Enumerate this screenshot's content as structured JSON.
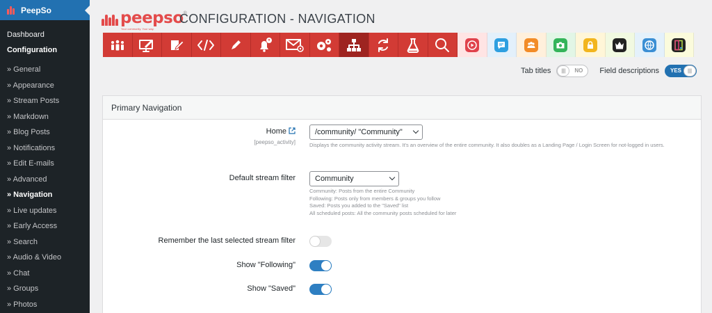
{
  "sidebar": {
    "title": "PeepSo",
    "top_items": [
      {
        "label": "Dashboard",
        "current": false
      },
      {
        "label": "Configuration",
        "current": true
      }
    ],
    "sub_items": [
      {
        "label": "» General",
        "active": false
      },
      {
        "label": "» Appearance",
        "active": false
      },
      {
        "label": "» Stream Posts",
        "active": false
      },
      {
        "label": "» Markdown",
        "active": false
      },
      {
        "label": "» Blog Posts",
        "active": false
      },
      {
        "label": "» Notifications",
        "active": false
      },
      {
        "label": "» Edit E-mails",
        "active": false
      },
      {
        "label": "» Advanced",
        "active": false
      },
      {
        "label": "» Navigation",
        "active": true
      },
      {
        "label": "» Live updates",
        "active": false
      },
      {
        "label": "» Early Access",
        "active": false
      },
      {
        "label": "» Search",
        "active": false
      },
      {
        "label": "» Audio & Video",
        "active": false
      },
      {
        "label": "» Chat",
        "active": false
      },
      {
        "label": "» Groups",
        "active": false
      },
      {
        "label": "» Photos",
        "active": false
      }
    ]
  },
  "brand": {
    "word": "peepso",
    "tagline": "Your community. Your way.",
    "reg": "®"
  },
  "page_title": "CONFIGURATION - NAVIGATION",
  "tabs": [
    {
      "icon": "people-icon",
      "type": "red",
      "selected": false
    },
    {
      "icon": "monitor-pen-icon",
      "type": "red",
      "selected": false
    },
    {
      "icon": "edit-note-icon",
      "type": "red",
      "selected": false
    },
    {
      "icon": "code-icon",
      "type": "red",
      "selected": false
    },
    {
      "icon": "pencil-icon",
      "type": "red",
      "selected": false
    },
    {
      "icon": "bell-alert-icon",
      "type": "red",
      "selected": false
    },
    {
      "icon": "mail-gear-icon",
      "type": "red",
      "selected": false
    },
    {
      "icon": "gears-icon",
      "type": "red",
      "selected": false
    },
    {
      "icon": "sitemap-icon",
      "type": "red",
      "selected": true
    },
    {
      "icon": "refresh-icon",
      "type": "red",
      "selected": false
    },
    {
      "icon": "flask-icon",
      "type": "red",
      "selected": false
    },
    {
      "icon": "search-icon",
      "type": "red",
      "selected": false
    },
    {
      "icon": "play-icon",
      "type": "addon",
      "bg": "#ffe4e4",
      "badge": "#e0424c"
    },
    {
      "icon": "chat-icon",
      "type": "addon",
      "bg": "#e3f0fb",
      "badge": "#2e9fe0"
    },
    {
      "icon": "group-icon",
      "type": "addon",
      "bg": "#fff0dc",
      "badge": "#f28c28"
    },
    {
      "icon": "camera-icon",
      "type": "addon",
      "bg": "#e2f6e6",
      "badge": "#34b45a"
    },
    {
      "icon": "lock-icon",
      "type": "addon",
      "bg": "#fff6d8",
      "badge": "#f2b51e"
    },
    {
      "icon": "crown-icon",
      "type": "addon",
      "bg": "#f1f9e1",
      "badge": "#222222"
    },
    {
      "icon": "globe-badge-icon",
      "type": "addon",
      "bg": "#e4f1fb",
      "badge": "#3b8fd4"
    },
    {
      "icon": "frame-icon",
      "type": "addon",
      "bg": "#fbfbdc",
      "badge": "#222222"
    }
  ],
  "toggles": {
    "tab_titles_label": "Tab titles",
    "tab_titles_state": "NO",
    "field_desc_label": "Field descriptions",
    "field_desc_state": "YES"
  },
  "panel": {
    "title": "Primary Navigation",
    "home": {
      "label": "Home",
      "sublabel": "[peepso_activity]",
      "value": "/community/ \"Community\"",
      "description": "Displays the community activity stream. It's an overview of the entire community. It also doubles as a Landing Page / Login Screen for not-logged in users."
    },
    "stream_filter": {
      "label": "Default stream filter",
      "value": "Community",
      "descriptions": [
        "Community: Posts from the entire Community",
        "Following: Posts only from members & groups you follow",
        "Saved: Posts you added to the \"Saved\" list",
        "All scheduled posts: All the community posts scheduled for later"
      ]
    },
    "remember": {
      "label": "Remember the last selected stream filter",
      "on": false
    },
    "show_following": {
      "label": "Show \"Following\"",
      "on": true
    },
    "show_saved": {
      "label": "Show \"Saved\"",
      "on": true
    }
  },
  "colors": {
    "accent": "#2271b1",
    "brand_red": "#d23b35",
    "sidebar": "#1d2327"
  }
}
